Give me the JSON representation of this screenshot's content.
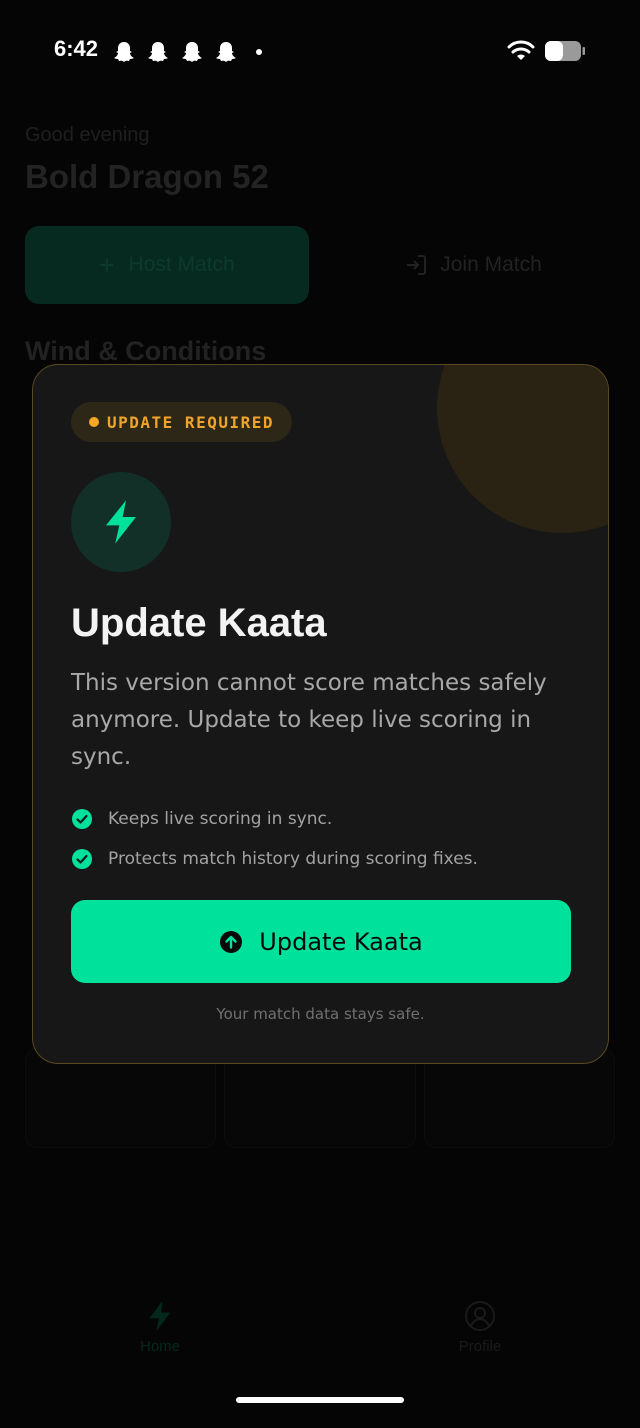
{
  "status_bar": {
    "time": "6:42",
    "notification_icons": [
      "snapchat-icon",
      "snapchat-icon",
      "snapchat-icon",
      "snapchat-icon"
    ],
    "battery_level": 0.5
  },
  "background": {
    "greeting": "Good evening",
    "username": "Bold Dragon 52",
    "host_match_label": "Host Match",
    "join_match_label": "Join Match",
    "section_title": "Wind & Conditions"
  },
  "modal": {
    "badge": "UPDATE REQUIRED",
    "title": "Update Kaata",
    "description": "This version cannot score matches safely anymore. Update to keep live scoring in sync.",
    "bullets": [
      "Keeps live scoring in sync.",
      "Protects match history during scoring fixes."
    ],
    "button_label": "Update Kaata",
    "footnote": "Your match data stays safe."
  },
  "tab_bar": {
    "home_label": "Home",
    "profile_label": "Profile"
  },
  "colors": {
    "accent": "#00e19b",
    "warning": "#f0a52a",
    "modal_bg": "#171717",
    "modal_border": "#5a4a1f"
  }
}
